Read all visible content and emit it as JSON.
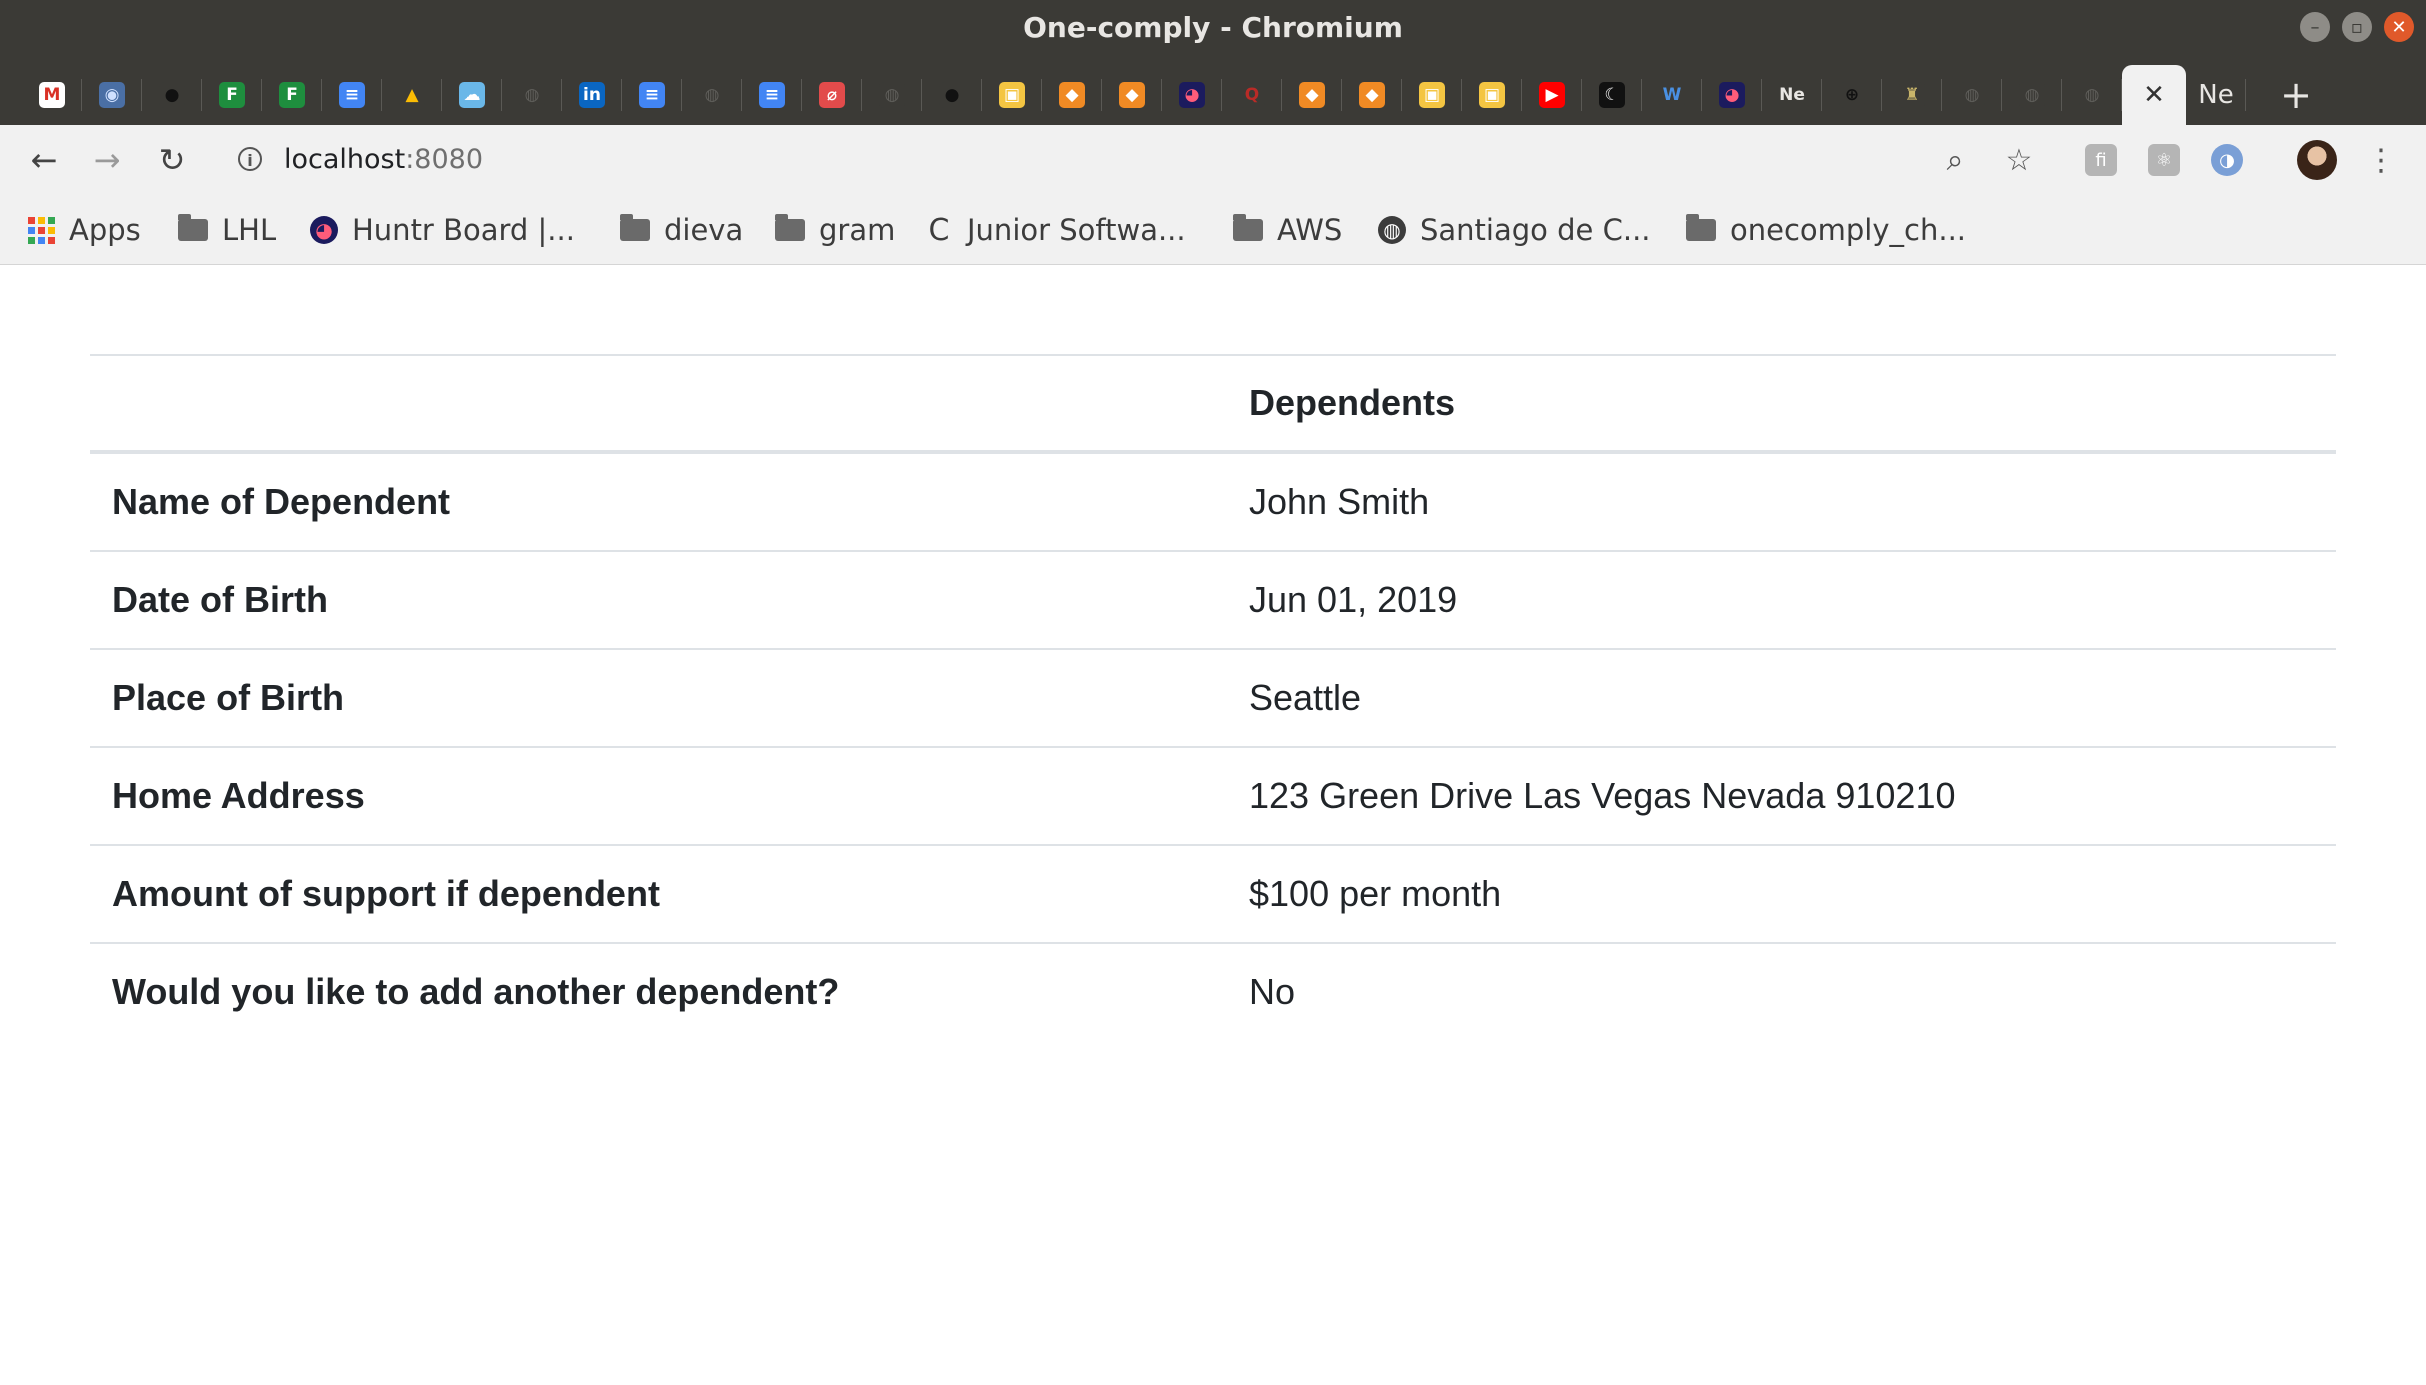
{
  "window": {
    "title": "One-comply - Chromium"
  },
  "tabs": [
    {
      "icon": "gmail-icon",
      "glyph": "M",
      "color": "#ffffff",
      "fg": "#d93025"
    },
    {
      "icon": "devtools-icon",
      "glyph": "◉",
      "color": "#4a6fa5",
      "fg": "#cfe0ff"
    },
    {
      "icon": "github-icon",
      "glyph": "●",
      "color": "#3b3a36",
      "fg": "#111111"
    },
    {
      "icon": "sheets-icon",
      "glyph": "F",
      "color": "#1e8e3e",
      "fg": "#ffffff"
    },
    {
      "icon": "sheets-icon",
      "glyph": "F",
      "color": "#1e8e3e",
      "fg": "#ffffff"
    },
    {
      "icon": "docs-icon",
      "glyph": "≡",
      "color": "#4285f4",
      "fg": "#ffffff"
    },
    {
      "icon": "drive-icon",
      "glyph": "▲",
      "color": "#3b3a36",
      "fg": "#fbbc04"
    },
    {
      "icon": "cloud-icon",
      "glyph": "☁",
      "color": "#6ab7e8",
      "fg": "#ffffff"
    },
    {
      "icon": "globe-icon",
      "glyph": "◍",
      "color": "#3b3a36",
      "fg": "#5f5e5a"
    },
    {
      "icon": "linkedin-icon",
      "glyph": "in",
      "color": "#0a66c2",
      "fg": "#ffffff"
    },
    {
      "icon": "docs-icon",
      "glyph": "≡",
      "color": "#4285f4",
      "fg": "#ffffff"
    },
    {
      "icon": "globe-icon",
      "glyph": "◍",
      "color": "#3b3a36",
      "fg": "#5f5e5a"
    },
    {
      "icon": "docs-icon",
      "glyph": "≡",
      "color": "#4285f4",
      "fg": "#ffffff"
    },
    {
      "icon": "scribe-icon",
      "glyph": "⌀",
      "color": "#e24b4b",
      "fg": "#ffffff"
    },
    {
      "icon": "globe-icon",
      "glyph": "◍",
      "color": "#3b3a36",
      "fg": "#5f5e5a"
    },
    {
      "icon": "github-icon",
      "glyph": "●",
      "color": "#3b3a36",
      "fg": "#111111"
    },
    {
      "icon": "package-icon",
      "glyph": "▣",
      "color": "#f4c542",
      "fg": "#ffffff"
    },
    {
      "icon": "box-icon",
      "glyph": "◆",
      "color": "#f08a24",
      "fg": "#ffffff"
    },
    {
      "icon": "box-icon",
      "glyph": "◆",
      "color": "#f08a24",
      "fg": "#ffffff"
    },
    {
      "icon": "huntr-icon",
      "glyph": "◕",
      "color": "#1b1b5e",
      "fg": "#ff5c7a"
    },
    {
      "icon": "quora-icon",
      "glyph": "Q",
      "color": "#3b3a36",
      "fg": "#b92b27"
    },
    {
      "icon": "box-icon",
      "glyph": "◆",
      "color": "#f08a24",
      "fg": "#ffffff"
    },
    {
      "icon": "box-icon",
      "glyph": "◆",
      "color": "#f08a24",
      "fg": "#ffffff"
    },
    {
      "icon": "package-icon",
      "glyph": "▣",
      "color": "#f4c542",
      "fg": "#ffffff"
    },
    {
      "icon": "package-icon",
      "glyph": "▣",
      "color": "#f4c542",
      "fg": "#ffffff"
    },
    {
      "icon": "youtube-icon",
      "glyph": "▶",
      "color": "#ff0000",
      "fg": "#ffffff"
    },
    {
      "icon": "moon-icon",
      "glyph": "☾",
      "color": "#111111",
      "fg": "#eeeeee"
    },
    {
      "icon": "headset-icon",
      "glyph": "W",
      "color": "#3b3a36",
      "fg": "#4a90e2"
    },
    {
      "icon": "huntr-icon",
      "glyph": "◕",
      "color": "#1b1b5e",
      "fg": "#ff5c7a"
    },
    {
      "icon": "notion-icon",
      "glyph": "Ne",
      "color": "#3b3a36",
      "fg": "#e8e6e3"
    },
    {
      "icon": "target-icon",
      "glyph": "⊕",
      "color": "#3b3a36",
      "fg": "#111111"
    },
    {
      "icon": "bottle-icon",
      "glyph": "♜",
      "color": "#3b3a36",
      "fg": "#c9b56a"
    },
    {
      "icon": "globe-icon",
      "glyph": "◍",
      "color": "#3b3a36",
      "fg": "#5f5e5a"
    },
    {
      "icon": "globe-icon",
      "glyph": "◍",
      "color": "#3b3a36",
      "fg": "#5f5e5a"
    },
    {
      "icon": "globe-icon",
      "glyph": "◍",
      "color": "#3b3a36",
      "fg": "#5f5e5a"
    }
  ],
  "active_tab": {
    "close_glyph": "✕"
  },
  "trailing_tab": {
    "text": "Ne"
  },
  "new_tab": {
    "glyph": "+"
  },
  "toolbar": {
    "back": "←",
    "forward": "→",
    "reload": "↻",
    "url_host": "localhost",
    "url_port": ":8080",
    "zoom": "⌕",
    "star": "☆",
    "menu": "⋮"
  },
  "bookmarks": [
    {
      "type": "apps",
      "label": "Apps"
    },
    {
      "type": "folder",
      "label": "LHL"
    },
    {
      "type": "site",
      "label": "Huntr Board |...",
      "icon": "huntr-icon"
    },
    {
      "type": "folder",
      "label": "dieva"
    },
    {
      "type": "folder",
      "label": "gram"
    },
    {
      "type": "site",
      "label": "Junior Softwa...",
      "icon": "c-icon"
    },
    {
      "type": "folder",
      "label": "AWS"
    },
    {
      "type": "site",
      "label": "Santiago de C...",
      "icon": "globe-icon"
    },
    {
      "type": "folder",
      "label": "onecomply_ch..."
    }
  ],
  "table": {
    "header": [
      "",
      "Dependents"
    ],
    "rows": [
      {
        "label": "Name of Dependent",
        "value": "John Smith"
      },
      {
        "label": "Date of Birth",
        "value": "Jun 01, 2019"
      },
      {
        "label": "Place of Birth",
        "value": "Seattle"
      },
      {
        "label": "Home Address",
        "value": "123 Green Drive Las Vegas Nevada 910210"
      },
      {
        "label": "Amount of support if dependent",
        "value": "$100 per month"
      },
      {
        "label": "Would you like to add another dependent?",
        "value": "No"
      }
    ]
  }
}
